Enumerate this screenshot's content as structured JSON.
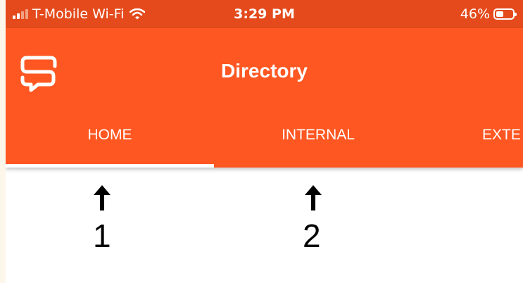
{
  "status_bar": {
    "carrier": "T-Mobile Wi-Fi",
    "time": "3:29 PM",
    "battery": "46%",
    "battery_level": 0.46,
    "signal_bars_filled": 2,
    "signal_bars_total": 4
  },
  "app_bar": {
    "title": "Directory",
    "logo_icon": "chat-bubble-s-logo-icon",
    "brand_color": "#ff5722"
  },
  "tabs": [
    {
      "label": "HOME",
      "selected": true
    },
    {
      "label": "INTERNAL",
      "selected": false
    },
    {
      "label": "EXTE",
      "selected": false
    }
  ],
  "annotations": {
    "label_1": "1",
    "label_2": "2"
  }
}
